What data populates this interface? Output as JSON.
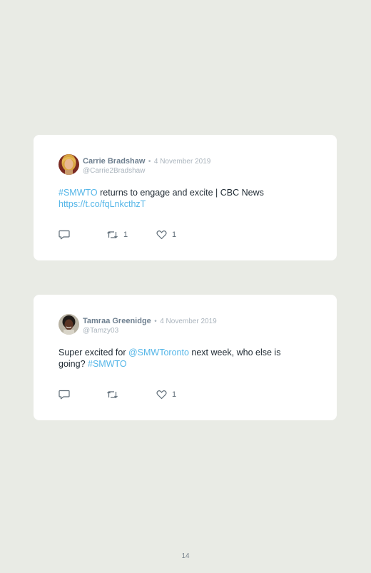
{
  "tweets": [
    {
      "author": "Carrie Bradshaw",
      "separator": "•",
      "date": "4 November 2019",
      "handle": "@Carrie2Bradshaw",
      "text": {
        "hashtag": "#SMWTO",
        "body": " returns to engage and excite | CBC News ",
        "link": "https://t.co/fqLnkcthzT"
      },
      "retweets": "1",
      "likes": "1",
      "avatar_icon": "avatar-woman-blonde"
    },
    {
      "author": "Tamraa Greenidge",
      "separator": "•",
      "date": "4 November 2019",
      "handle": "@Tamzy03",
      "text": {
        "prefix": "Super excited for ",
        "mention": "@SMWToronto",
        "middle": " next week, who else is going? ",
        "hashtag": "#SMWTO"
      },
      "retweets": "",
      "likes": "1",
      "avatar_icon": "avatar-woman-dark-hair"
    }
  ],
  "page_number": "14",
  "colors": {
    "background": "#e9ebe5",
    "card": "#ffffff",
    "link": "#55b6e8",
    "author": "#6f8090",
    "muted": "#aab4bd"
  },
  "icons": [
    "reply-icon",
    "retweet-icon",
    "like-icon"
  ]
}
